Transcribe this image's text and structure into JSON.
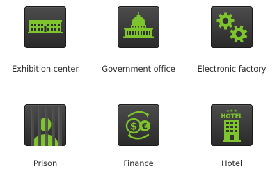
{
  "accent_color": "#7dc42d",
  "tile_color": "#363636",
  "tiles": [
    {
      "label": "Exhibition center",
      "icon": "exhibition-center-icon"
    },
    {
      "label": "Government office",
      "icon": "government-office-icon"
    },
    {
      "label": "Electronic factory",
      "icon": "electronic-factory-icon"
    },
    {
      "label": "Prison",
      "icon": "prison-icon"
    },
    {
      "label": "Finance",
      "icon": "finance-icon"
    },
    {
      "label": "Hotel",
      "icon": "hotel-icon"
    }
  ],
  "icon_texts": {
    "hotel_sign": "HOTEL",
    "hotel_stars": "★★★",
    "finance_dollar": "$",
    "finance_euro": "€"
  }
}
